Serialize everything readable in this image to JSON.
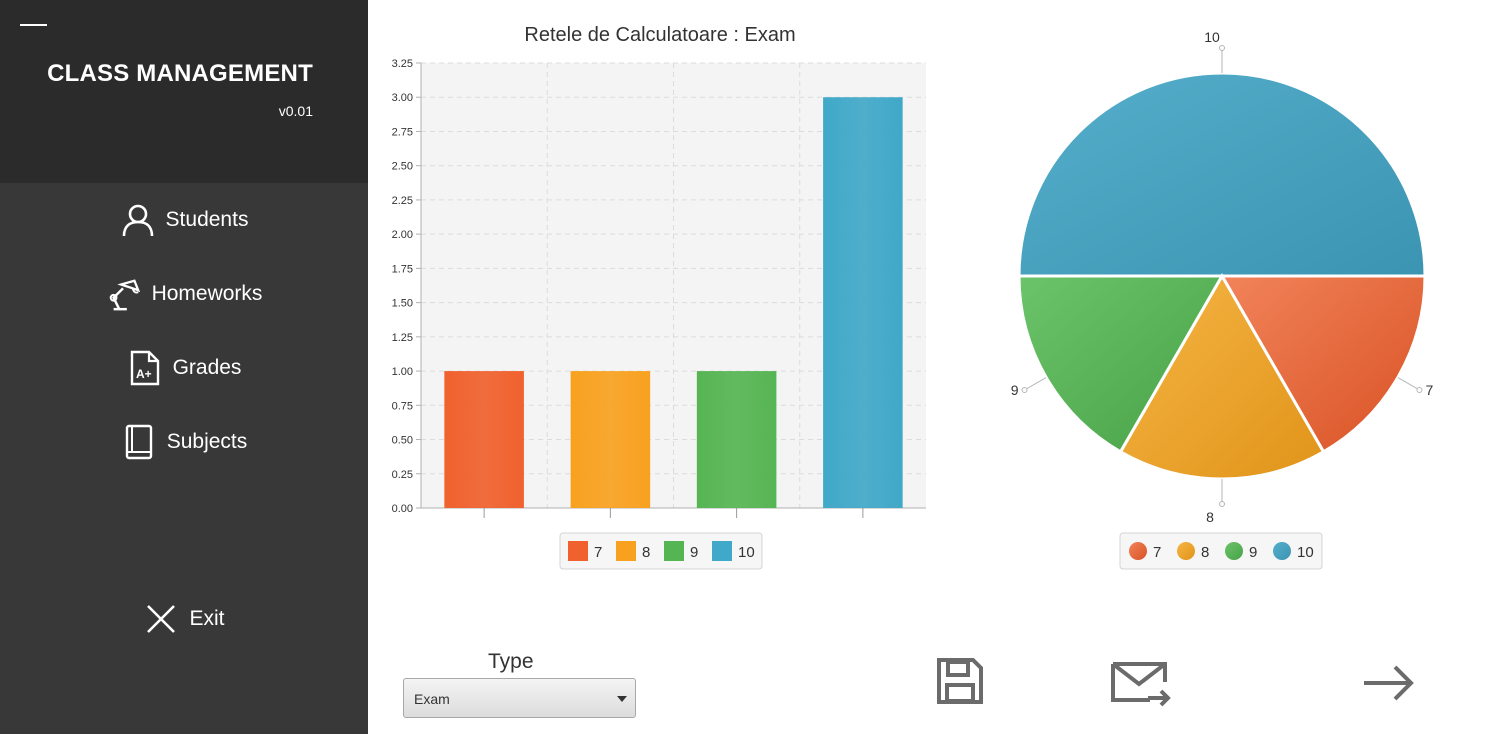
{
  "app": {
    "title": "CLASS MANAGEMENT",
    "version": "v0.01"
  },
  "nav": [
    {
      "label": "Students",
      "icon": "user-icon"
    },
    {
      "label": "Homeworks",
      "icon": "desk-lamp-icon"
    },
    {
      "label": "Grades",
      "icon": "grade-file-icon"
    },
    {
      "label": "Subjects",
      "icon": "book-icon"
    }
  ],
  "exit": {
    "label": "Exit",
    "icon": "close-icon"
  },
  "controls": {
    "type_label": "Type",
    "type_value": "Exam"
  },
  "actions": {
    "save_icon": "save-icon",
    "email_icon": "email-send-icon",
    "next_icon": "arrow-right-icon"
  },
  "colors": {
    "sidebar": "#383838",
    "sidebar_top": "#2b2b2b",
    "s7": "#f0612d",
    "s8": "#f8a11f",
    "s9": "#56b553",
    "s10": "#40a8c8"
  },
  "chart_data": [
    {
      "type": "bar",
      "title": "Retele de Calculatoare : Exam",
      "series": [
        {
          "name": "7",
          "values": [
            1
          ]
        },
        {
          "name": "8",
          "values": [
            1
          ]
        },
        {
          "name": "9",
          "values": [
            1
          ]
        },
        {
          "name": "10",
          "values": [
            3
          ]
        }
      ],
      "y_ticks": [
        "0.00",
        "0.25",
        "0.50",
        "0.75",
        "1.00",
        "1.25",
        "1.50",
        "1.75",
        "2.00",
        "2.25",
        "2.50",
        "2.75",
        "3.00",
        "3.25"
      ],
      "ylim": [
        0,
        3.25
      ],
      "grid": true,
      "legend": "bottom"
    },
    {
      "type": "pie",
      "slices": [
        {
          "label": "7",
          "value": 1
        },
        {
          "label": "8",
          "value": 1
        },
        {
          "label": "9",
          "value": 1
        },
        {
          "label": "10",
          "value": 3
        }
      ],
      "legend": "bottom"
    }
  ]
}
